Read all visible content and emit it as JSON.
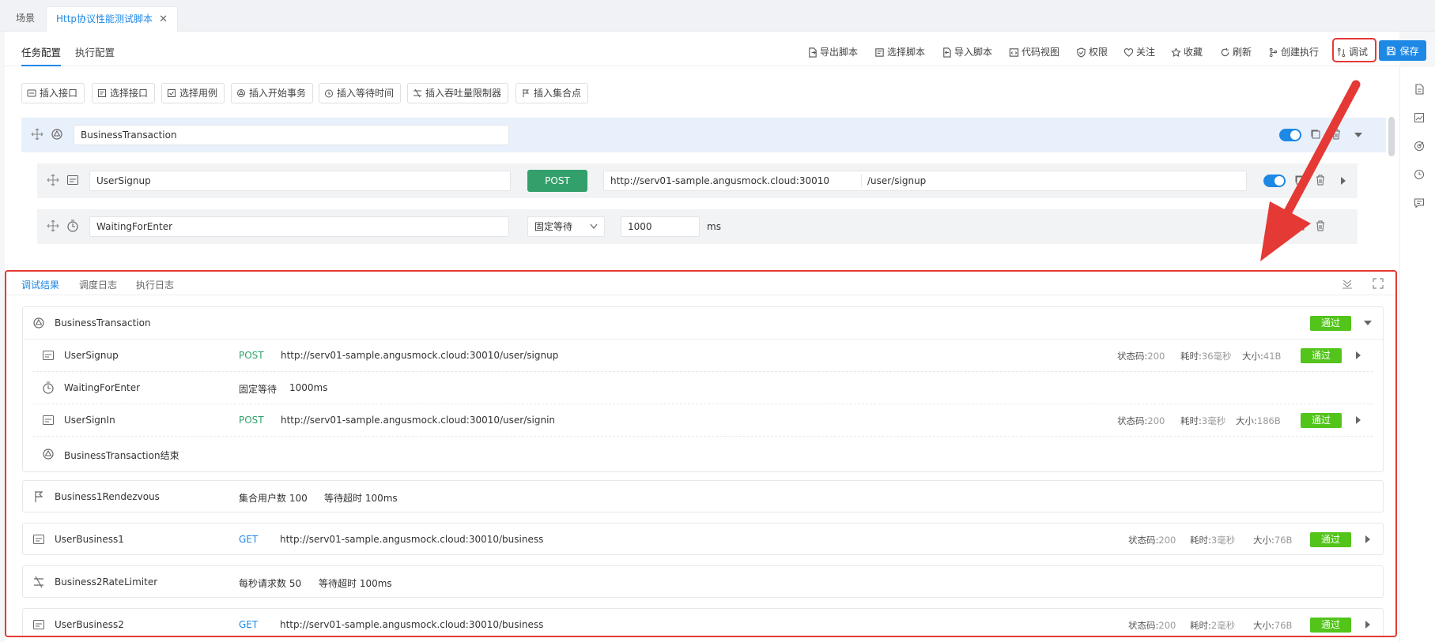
{
  "top_tabs": [
    {
      "label": "场景"
    },
    {
      "label": "Http协议性能测试脚本"
    }
  ],
  "sub_tabs": [
    {
      "label": "任务配置"
    },
    {
      "label": "执行配置"
    }
  ],
  "toolbar": {
    "export": "导出脚本",
    "select_script": "选择脚本",
    "import": "导入脚本",
    "code_view": "代码视图",
    "permission": "权限",
    "follow": "关注",
    "favorite": "收藏",
    "refresh": "刷新",
    "create_exec": "创建执行",
    "debug": "调试",
    "save": "保存"
  },
  "insert_buttons": [
    {
      "label": "插入接口"
    },
    {
      "label": "选择接口"
    },
    {
      "label": "选择用例"
    },
    {
      "label": "插入开始事务"
    },
    {
      "label": "插入等待时间"
    },
    {
      "label": "插入吞吐量限制器"
    },
    {
      "label": "插入集合点"
    }
  ],
  "editor": {
    "transaction_name": "BusinessTransaction",
    "signup_name": "UserSignup",
    "signup_method": "POST",
    "signup_host": "http://serv01-sample.angusmock.cloud:30010",
    "signup_path": "/user/signup",
    "wait_name": "WaitingForEnter",
    "wait_type": "固定等待",
    "wait_value": "1000",
    "wait_unit": "ms"
  },
  "result_tabs": [
    {
      "label": "调试结果"
    },
    {
      "label": "调度日志"
    },
    {
      "label": "执行日志"
    }
  ],
  "results": {
    "transaction": {
      "name": "BusinessTransaction",
      "status": "通过"
    },
    "signup": {
      "name": "UserSignup",
      "method": "POST",
      "url": "http://serv01-sample.angusmock.cloud:30010/user/signup",
      "code_label": "状态码:",
      "code": "200",
      "time_label": "耗时:",
      "time": "36毫秒",
      "size_label": "大小:",
      "size": "41B",
      "status": "通过"
    },
    "wait": {
      "name": "WaitingForEnter",
      "type": "固定等待",
      "value": "1000ms"
    },
    "signin": {
      "name": "UserSignIn",
      "method": "POST",
      "url": "http://serv01-sample.angusmock.cloud:30010/user/signin",
      "code_label": "状态码:",
      "code": "200",
      "time_label": "耗时:",
      "time": "3毫秒",
      "size_label": "大小:",
      "size": "186B",
      "status": "通过"
    },
    "transaction_end": {
      "name": "BusinessTransaction结束"
    },
    "rendezvous": {
      "name": "Business1Rendezvous",
      "users": "集合用户数 100",
      "timeout": "等待超时 100ms"
    },
    "business1": {
      "name": "UserBusiness1",
      "method": "GET",
      "url": "http://serv01-sample.angusmock.cloud:30010/business",
      "code_label": "状态码:",
      "code": "200",
      "time_label": "耗时:",
      "time": "3毫秒",
      "size_label": "大小:",
      "size": "76B",
      "status": "通过"
    },
    "limiter": {
      "name": "Business2RateLimiter",
      "rate": "每秒请求数 50",
      "timeout": "等待超时 100ms"
    },
    "business2": {
      "name": "UserBusiness2",
      "method": "GET",
      "url": "http://serv01-sample.angusmock.cloud:30010/business",
      "code_label": "状态码:",
      "code": "200",
      "time_label": "耗时:",
      "time": "2毫秒",
      "size_label": "大小:",
      "size": "76B",
      "status": "通过"
    }
  },
  "colors": {
    "accent": "#1e88e5",
    "pass": "#52c41a",
    "post": "#33a06b",
    "highlight": "#e53935"
  }
}
